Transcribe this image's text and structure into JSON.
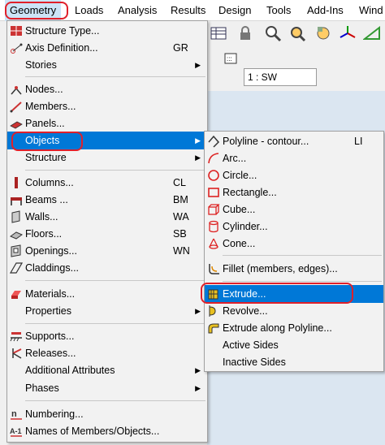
{
  "menubar": {
    "items": [
      "Geometry",
      "Loads",
      "Analysis",
      "Results",
      "Design",
      "Tools",
      "Add-Ins",
      "Wind"
    ]
  },
  "toolbar": {
    "view_select": "1 : SW"
  },
  "geometry_menu": {
    "items": [
      {
        "label": "Structure Type...",
        "icon": "structure-type-icon"
      },
      {
        "label": "Axis Definition...",
        "shortcut": "GR",
        "icon": "axis-icon"
      },
      {
        "label": "Stories",
        "submenu": true
      },
      {
        "label": "Nodes...",
        "icon": "nodes-icon"
      },
      {
        "label": "Members...",
        "icon": "members-icon"
      },
      {
        "label": "Panels...",
        "icon": "panels-icon"
      },
      {
        "label": "Objects",
        "submenu": true
      },
      {
        "label": "Structure",
        "submenu": true
      },
      {
        "label": "Columns...",
        "shortcut": "CL",
        "icon": "columns-icon"
      },
      {
        "label": "Beams ...",
        "shortcut": "BM",
        "icon": "beams-icon"
      },
      {
        "label": "Walls...",
        "shortcut": "WA",
        "icon": "walls-icon"
      },
      {
        "label": "Floors...",
        "shortcut": "SB",
        "icon": "floors-icon"
      },
      {
        "label": "Openings...",
        "shortcut": "WN",
        "icon": "openings-icon"
      },
      {
        "label": "Claddings...",
        "icon": "claddings-icon"
      },
      {
        "label": "Materials...",
        "icon": "materials-icon"
      },
      {
        "label": "Properties",
        "submenu": true
      },
      {
        "label": "Supports...",
        "icon": "supports-icon"
      },
      {
        "label": "Releases...",
        "icon": "releases-icon"
      },
      {
        "label": "Additional Attributes",
        "submenu": true
      },
      {
        "label": "Phases",
        "submenu": true
      },
      {
        "label": "Numbering...",
        "icon": "numbering-icon"
      },
      {
        "label": "Names of Members/Objects...",
        "icon": "names-icon"
      }
    ]
  },
  "objects_menu": {
    "items": [
      {
        "label": "Polyline - contour...",
        "shortcut": "LI",
        "icon": "polyline-icon"
      },
      {
        "label": "Arc...",
        "icon": "arc-icon"
      },
      {
        "label": "Circle...",
        "icon": "circle-icon"
      },
      {
        "label": "Rectangle...",
        "icon": "rectangle-icon"
      },
      {
        "label": "Cube...",
        "icon": "cube-icon"
      },
      {
        "label": "Cylinder...",
        "icon": "cylinder-icon"
      },
      {
        "label": "Cone...",
        "icon": "cone-icon"
      },
      {
        "label": "Fillet (members, edges)...",
        "icon": "fillet-icon"
      },
      {
        "label": "Extrude...",
        "icon": "extrude-icon"
      },
      {
        "label": "Revolve...",
        "icon": "revolve-icon"
      },
      {
        "label": "Extrude along Polyline...",
        "icon": "extrude-polyline-icon"
      },
      {
        "label": "Active Sides"
      },
      {
        "label": "Inactive Sides"
      }
    ]
  },
  "colors": {
    "highlight": "#0078d7",
    "annotation": "#e0202a",
    "menu_bg": "#f2f2f2"
  }
}
